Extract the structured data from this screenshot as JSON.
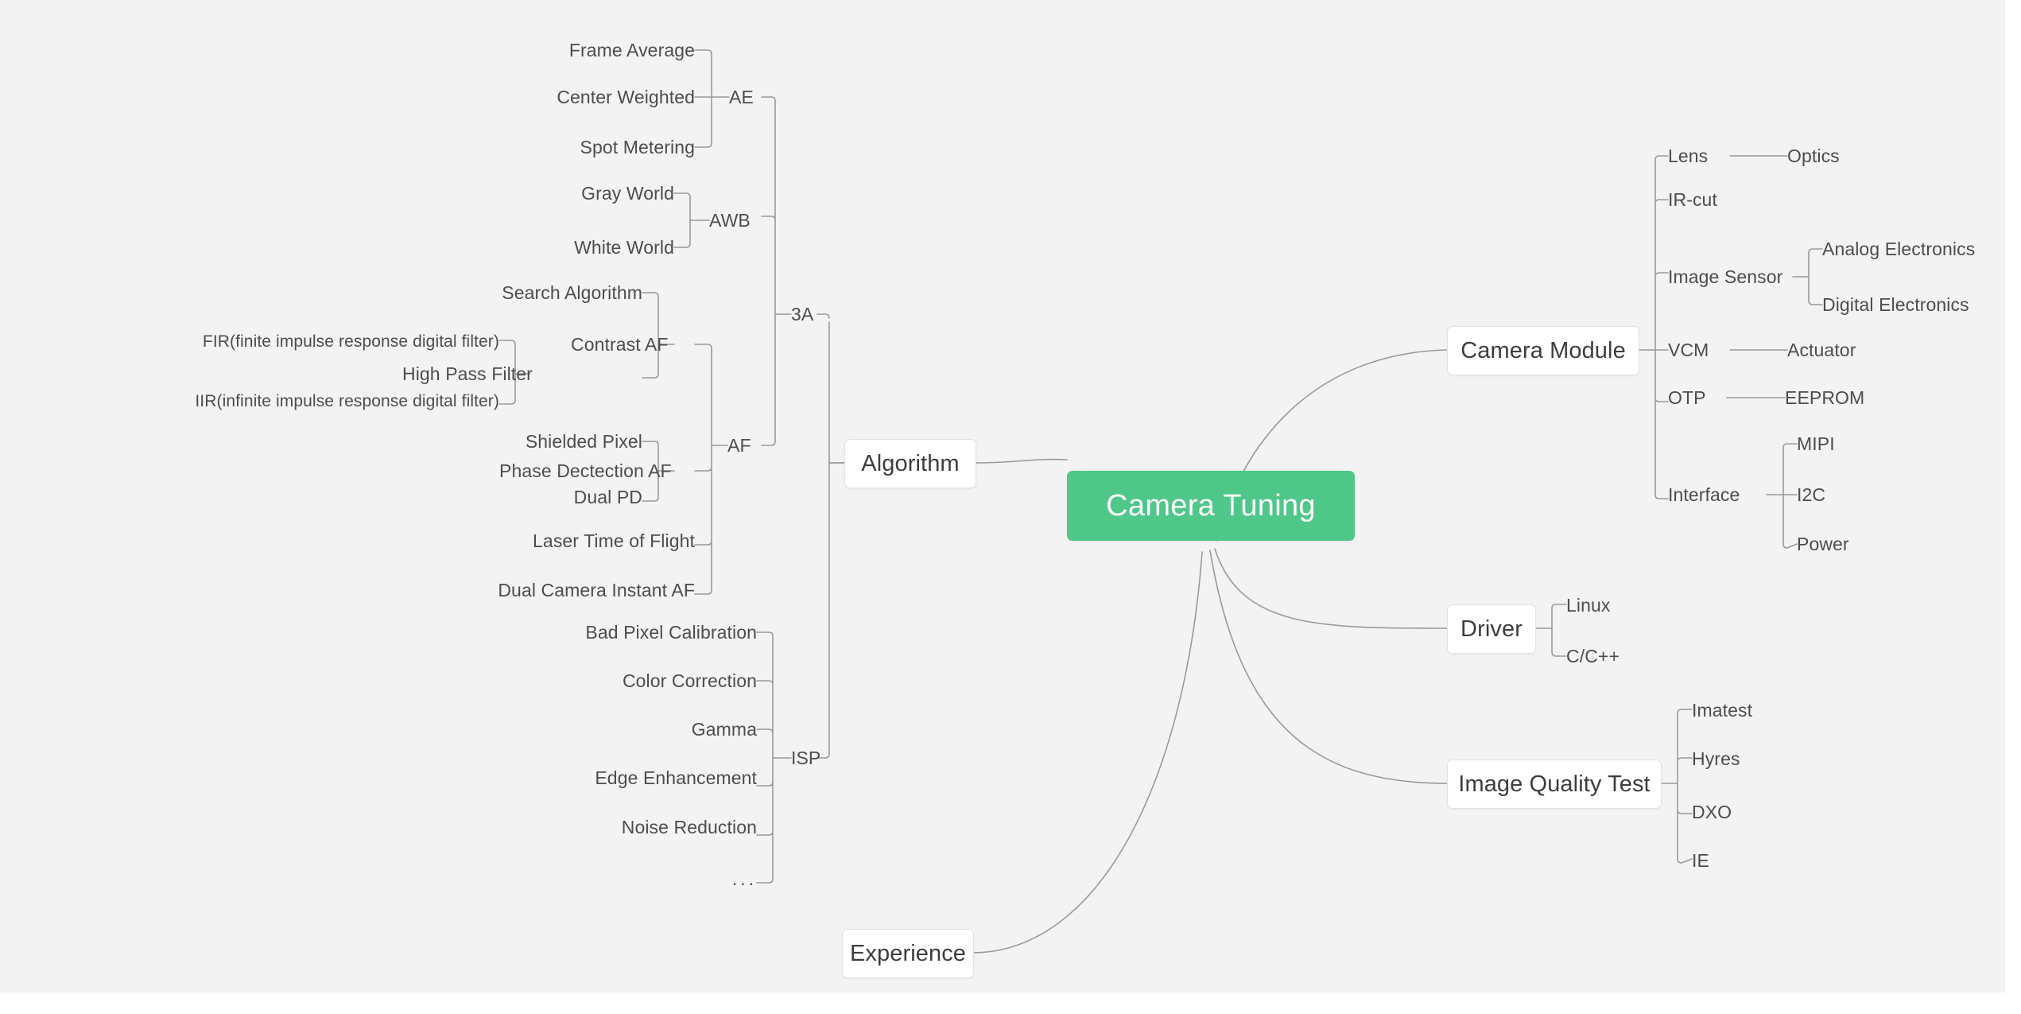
{
  "canvas": {
    "background": "#f3f3f3",
    "page_background": "#ffffff",
    "edge_color": "#9a9a9a",
    "root_fill": "#4ec789",
    "root_text_color": "#ffffff",
    "node_fill": "#ffffff",
    "node_border": "#e2e2e2",
    "text_color": "#4d4d4d"
  },
  "root": {
    "label": "Camera Tuning"
  },
  "mindmap": {
    "type": "mindmap",
    "root": "Camera Tuning",
    "branches": [
      {
        "label": "Algorithm",
        "side": "left",
        "children": [
          {
            "label": "3A",
            "children": [
              {
                "label": "AE",
                "children": [
                  {
                    "label": "Frame Average"
                  },
                  {
                    "label": "Center Weighted"
                  },
                  {
                    "label": "Spot Metering"
                  }
                ]
              },
              {
                "label": "AWB",
                "children": [
                  {
                    "label": "Gray World"
                  },
                  {
                    "label": "White World"
                  }
                ]
              },
              {
                "label": "AF",
                "children": [
                  {
                    "label": "Contrast AF",
                    "children": [
                      {
                        "label": "Search Algorithm"
                      },
                      {
                        "label": "High Pass Filter",
                        "children": [
                          {
                            "label": "FIR(finite impulse response digital filter)"
                          },
                          {
                            "label": "IIR(infinite impulse response digital filter)"
                          }
                        ]
                      }
                    ]
                  },
                  {
                    "label": "Phase Dectection AF",
                    "children": [
                      {
                        "label": "Shielded Pixel"
                      },
                      {
                        "label": "Dual PD"
                      }
                    ]
                  },
                  {
                    "label": "Laser Time of Flight"
                  },
                  {
                    "label": "Dual Camera Instant AF"
                  }
                ]
              }
            ]
          },
          {
            "label": "ISP",
            "children": [
              {
                "label": "Bad Pixel Calibration"
              },
              {
                "label": "Color Correction"
              },
              {
                "label": "Gamma"
              },
              {
                "label": "Edge Enhancement"
              },
              {
                "label": "Noise Reduction"
              },
              {
                "label": "..."
              }
            ]
          }
        ]
      },
      {
        "label": "Camera Module",
        "side": "right",
        "children": [
          {
            "label": "Lens",
            "children": [
              {
                "label": "Optics"
              }
            ]
          },
          {
            "label": "IR-cut"
          },
          {
            "label": "Image Sensor",
            "children": [
              {
                "label": "Analog Electronics"
              },
              {
                "label": "Digital Electronics"
              }
            ]
          },
          {
            "label": "VCM",
            "children": [
              {
                "label": "Actuator"
              }
            ]
          },
          {
            "label": "OTP",
            "children": [
              {
                "label": "EEPROM"
              }
            ]
          },
          {
            "label": "Interface",
            "children": [
              {
                "label": "MIPI"
              },
              {
                "label": "I2C"
              },
              {
                "label": "Power"
              }
            ]
          }
        ]
      },
      {
        "label": "Driver",
        "side": "right",
        "children": [
          {
            "label": "Linux"
          },
          {
            "label": "C/C++"
          }
        ]
      },
      {
        "label": "Image Quality Test",
        "side": "right",
        "children": [
          {
            "label": "Imatest"
          },
          {
            "label": "Hyres"
          },
          {
            "label": "DXO"
          },
          {
            "label": "IE"
          }
        ]
      },
      {
        "label": "Experience",
        "side": "left",
        "children": []
      }
    ]
  },
  "labels": {
    "algorithm": "Algorithm",
    "camera_module": "Camera Module",
    "driver": "Driver",
    "image_quality_test": "Image Quality Test",
    "experience": "Experience",
    "three_a": "3A",
    "isp": "ISP",
    "ae": "AE",
    "awb": "AWB",
    "af": "AF",
    "frame_average": "Frame Average",
    "center_weighted": "Center Weighted",
    "spot_metering": "Spot Metering",
    "gray_world": "Gray World",
    "white_world": "White World",
    "contrast_af": "Contrast AF",
    "search_algorithm": "Search Algorithm",
    "high_pass_filter": "High Pass Filter",
    "fir": "FIR(finite impulse response digital filter)",
    "iir": "IIR(infinite impulse response digital filter)",
    "phase_detection_af": "Phase Dectection AF",
    "shielded_pixel": "Shielded Pixel",
    "dual_pd": "Dual PD",
    "laser_tof": "Laser Time of Flight",
    "dual_camera_instant_af": "Dual Camera Instant AF",
    "bad_pixel_calibration": "Bad Pixel Calibration",
    "color_correction": "Color Correction",
    "gamma": "Gamma",
    "edge_enhancement": "Edge Enhancement",
    "noise_reduction": "Noise Reduction",
    "isp_more": "...",
    "lens": "Lens",
    "optics": "Optics",
    "ir_cut": "IR-cut",
    "image_sensor": "Image Sensor",
    "analog_electronics": "Analog Electronics",
    "digital_electronics": "Digital Electronics",
    "vcm": "VCM",
    "actuator": "Actuator",
    "otp": "OTP",
    "eeprom": "EEPROM",
    "interface": "Interface",
    "mipi": "MIPI",
    "i2c": "I2C",
    "power": "Power",
    "linux": "Linux",
    "cpp": "C/C++",
    "imatest": "Imatest",
    "hyres": "Hyres",
    "dxo": "DXO",
    "ie": "IE"
  }
}
